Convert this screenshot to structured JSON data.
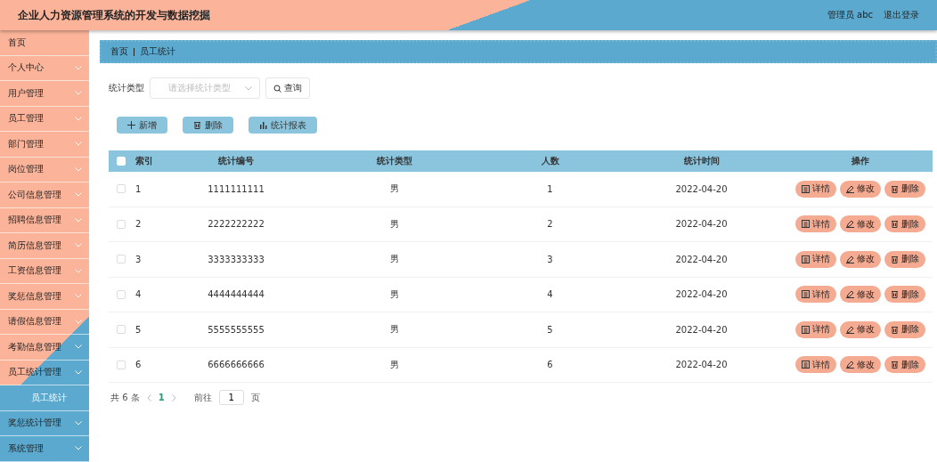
{
  "header": {
    "title": "企业人力资源管理系统的开发与数据挖掘",
    "user": "管理员 abc",
    "logout": "退出登录"
  },
  "sidebar": {
    "items": [
      {
        "label": "首页",
        "kind": "link"
      },
      {
        "label": "个人中心",
        "kind": "menu"
      },
      {
        "label": "用户管理",
        "kind": "menu"
      },
      {
        "label": "员工管理",
        "kind": "menu"
      },
      {
        "label": "部门管理",
        "kind": "menu"
      },
      {
        "label": "岗位管理",
        "kind": "menu"
      },
      {
        "label": "公司信息管理",
        "kind": "menu"
      },
      {
        "label": "招聘信息管理",
        "kind": "menu"
      },
      {
        "label": "简历信息管理",
        "kind": "menu"
      },
      {
        "label": "工资信息管理",
        "kind": "menu"
      },
      {
        "label": "奖惩信息管理",
        "kind": "menu"
      },
      {
        "label": "请假信息管理",
        "kind": "menu"
      },
      {
        "label": "考勤信息管理",
        "kind": "menu"
      },
      {
        "label": "员工统计管理",
        "kind": "menu",
        "children": [
          {
            "label": "员工统计",
            "selected": true
          }
        ]
      },
      {
        "label": "奖惩统计管理",
        "kind": "menu"
      },
      {
        "label": "系统管理",
        "kind": "menu"
      }
    ]
  },
  "breadcrumb": [
    "首页",
    "员工统计"
  ],
  "filter": {
    "label": "统计类型",
    "placeholder": "请选择统计类型",
    "search_button": "查询"
  },
  "toolbar": [
    {
      "label": "新增",
      "kind": "add"
    },
    {
      "label": "删除",
      "kind": "delete"
    },
    {
      "label": "统计报表",
      "kind": "report"
    }
  ],
  "table": {
    "header_checked": false,
    "columns": [
      "索引",
      "统计编号",
      "统计类型",
      "人数",
      "统计时间",
      "操作"
    ],
    "rows": [
      {
        "checked": false,
        "cells": [
          "1",
          "1111111111",
          "男",
          "1",
          "2022-04-20"
        ],
        "actions": [
          {
            "label": "详情",
            "kind": "detail"
          },
          {
            "label": "修改",
            "kind": "edit"
          },
          {
            "label": "删除",
            "kind": "delete"
          }
        ]
      },
      {
        "checked": false,
        "cells": [
          "2",
          "2222222222",
          "男",
          "2",
          "2022-04-20"
        ],
        "actions": [
          {
            "label": "详情",
            "kind": "detail"
          },
          {
            "label": "修改",
            "kind": "edit"
          },
          {
            "label": "删除",
            "kind": "delete"
          }
        ]
      },
      {
        "checked": false,
        "cells": [
          "3",
          "3333333333",
          "男",
          "3",
          "2022-04-20"
        ],
        "actions": [
          {
            "label": "详情",
            "kind": "detail"
          },
          {
            "label": "修改",
            "kind": "edit"
          },
          {
            "label": "删除",
            "kind": "delete"
          }
        ]
      },
      {
        "checked": false,
        "cells": [
          "4",
          "4444444444",
          "男",
          "4",
          "2022-04-20"
        ],
        "actions": [
          {
            "label": "详情",
            "kind": "detail"
          },
          {
            "label": "修改",
            "kind": "edit"
          },
          {
            "label": "删除",
            "kind": "delete"
          }
        ]
      },
      {
        "checked": false,
        "cells": [
          "5",
          "5555555555",
          "男",
          "5",
          "2022-04-20"
        ],
        "actions": [
          {
            "label": "详情",
            "kind": "detail"
          },
          {
            "label": "修改",
            "kind": "edit"
          },
          {
            "label": "删除",
            "kind": "delete"
          }
        ]
      },
      {
        "checked": false,
        "cells": [
          "6",
          "6666666666",
          "男",
          "6",
          "2022-04-20"
        ],
        "actions": [
          {
            "label": "详情",
            "kind": "detail"
          },
          {
            "label": "修改",
            "kind": "edit"
          },
          {
            "label": "删除",
            "kind": "delete"
          }
        ]
      }
    ]
  },
  "pagination": {
    "total": "共 6 条",
    "pages": [
      {
        "label": "1",
        "selected": true
      }
    ],
    "goto": "前往",
    "page_input": "1",
    "suffix": "页"
  }
}
